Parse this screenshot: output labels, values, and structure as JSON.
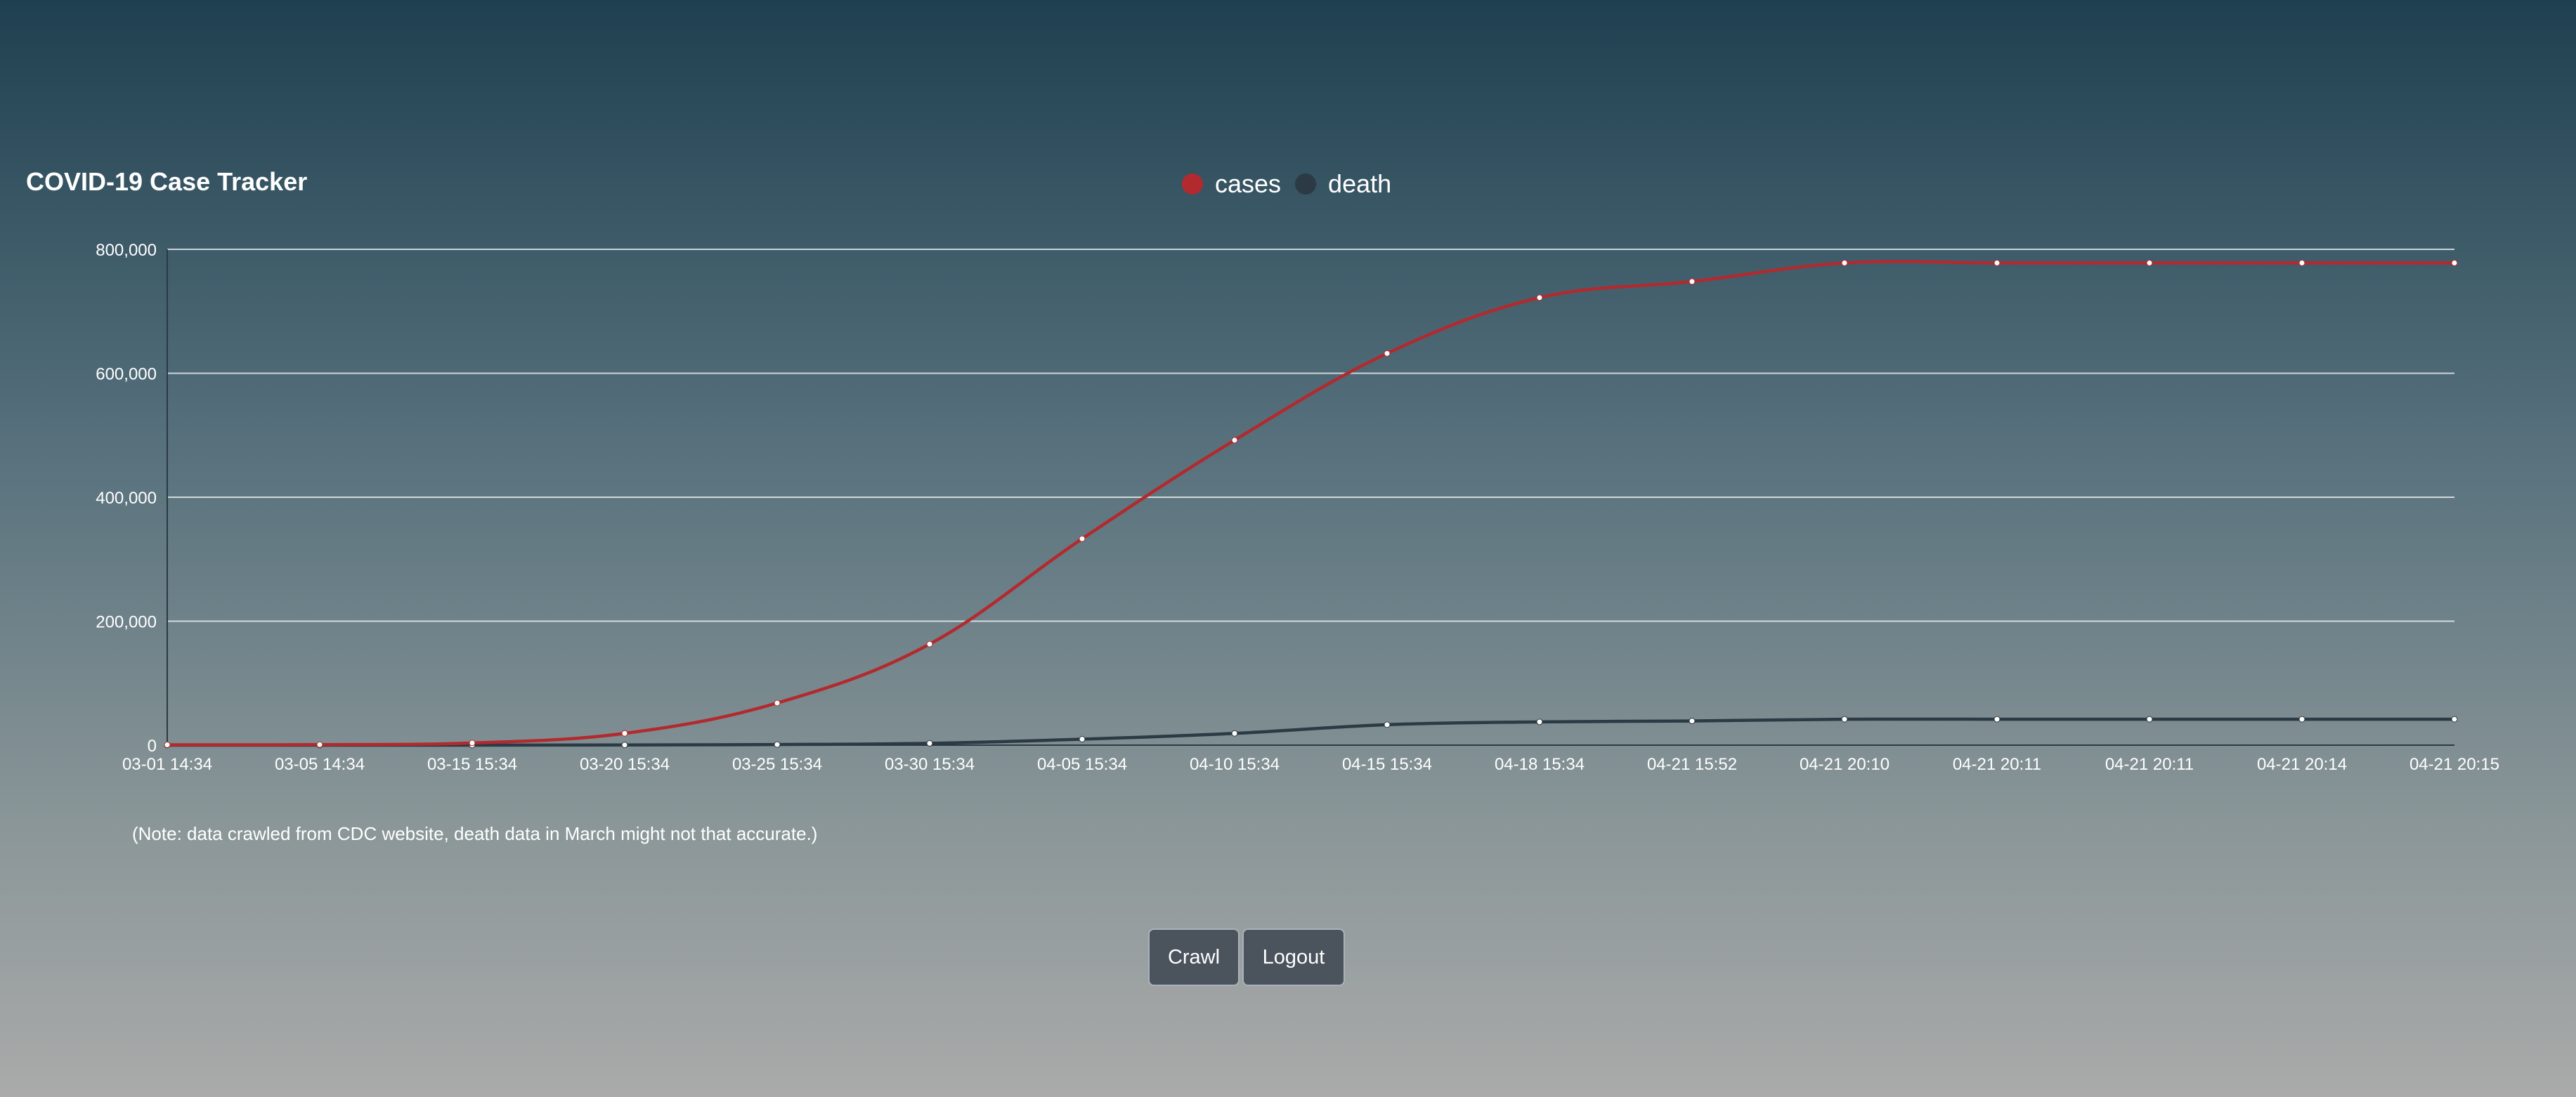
{
  "chart_data": {
    "type": "line",
    "title": "COVID-19 Case Tracker",
    "categories": [
      "03-01 14:34",
      "03-05 14:34",
      "03-15 15:34",
      "03-20 15:34",
      "03-25 15:34",
      "03-30 15:34",
      "04-05 15:34",
      "04-10 15:34",
      "04-15 15:34",
      "04-18 15:34",
      "04-21 15:52",
      "04-21 20:10",
      "04-21 20:11",
      "04-21 20:11",
      "04-21 20:14",
      "04-21 20:15"
    ],
    "series": [
      {
        "name": "cases",
        "color": "#b22a2e",
        "values": [
          500,
          800,
          3500,
          19000,
          68000,
          163000,
          333000,
          492000,
          632000,
          722000,
          748000,
          778000,
          778000,
          778000,
          778000,
          778000
        ]
      },
      {
        "name": "death",
        "color": "#2b3a44",
        "values": [
          10,
          15,
          60,
          250,
          1000,
          3000,
          9600,
          19000,
          33000,
          37500,
          39000,
          41800,
          41800,
          41800,
          41800,
          41800
        ]
      }
    ],
    "yticks": [
      "0",
      "200,000",
      "400,000",
      "600,000",
      "800,000"
    ],
    "ylim": [
      0,
      800000
    ],
    "grid": true,
    "legend_position": "top-center"
  },
  "note": "(Note: data crawled from CDC website, death data in March might not that accurate.)",
  "buttons": {
    "crawl": "Crawl",
    "logout": "Logout"
  }
}
